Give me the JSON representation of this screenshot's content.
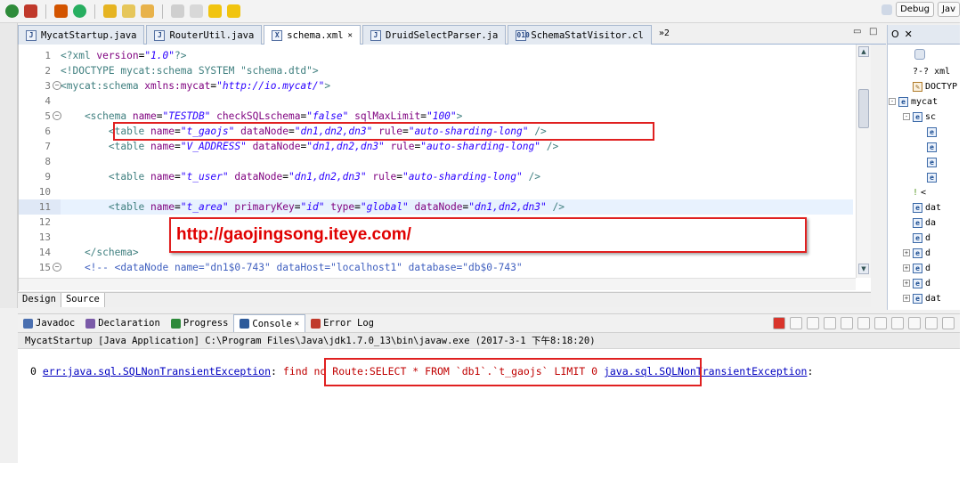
{
  "toolbar": {
    "perspective_debug": "Debug",
    "perspective_java": "Jav"
  },
  "editor_tabs": [
    {
      "label": "MycatStartup.java",
      "icon": "J"
    },
    {
      "label": "RouterUtil.java",
      "icon": "J"
    },
    {
      "label": "schema.xml",
      "icon": "X",
      "active": true
    },
    {
      "label": "DruidSelectParser.ja",
      "icon": "J"
    },
    {
      "label": "SchemaStatVisitor.cl",
      "icon": "010"
    }
  ],
  "editor_tabs_more": "»2",
  "editor": {
    "line_numbers": [
      "1",
      "2",
      "3",
      "4",
      "5",
      "6",
      "7",
      "8",
      "9",
      "10",
      "11",
      "12",
      "13",
      "14",
      "15"
    ],
    "lines": [
      {
        "parts": [
          {
            "t": "<?xml ",
            "c": "tg"
          },
          {
            "t": "version",
            "c": "at"
          },
          {
            "t": "=",
            "c": ""
          },
          {
            "t": "\"1.0\"",
            "c": "av"
          },
          {
            "t": "?>",
            "c": "tg"
          }
        ]
      },
      {
        "parts": [
          {
            "t": "<!DOCTYPE mycat:schema SYSTEM \"schema.dtd\">",
            "c": "tg"
          }
        ]
      },
      {
        "parts": [
          {
            "t": "<mycat:schema ",
            "c": "tg"
          },
          {
            "t": "xmlns:mycat",
            "c": "at"
          },
          {
            "t": "=",
            "c": ""
          },
          {
            "t": "\"http://io.mycat/\"",
            "c": "av"
          },
          {
            "t": ">",
            "c": "tg"
          }
        ]
      },
      {
        "parts": []
      },
      {
        "parts": [
          {
            "t": "    <schema ",
            "c": "tg"
          },
          {
            "t": "name",
            "c": "at"
          },
          {
            "t": "=",
            "c": ""
          },
          {
            "t": "\"TESTDB\"",
            "c": "av"
          },
          {
            "t": " ",
            "c": ""
          },
          {
            "t": "checkSQLschema",
            "c": "at"
          },
          {
            "t": "=",
            "c": ""
          },
          {
            "t": "\"false\"",
            "c": "av"
          },
          {
            "t": " ",
            "c": ""
          },
          {
            "t": "sqlMaxLimit",
            "c": "at"
          },
          {
            "t": "=",
            "c": ""
          },
          {
            "t": "\"100\"",
            "c": "av"
          },
          {
            "t": ">",
            "c": "tg"
          }
        ]
      },
      {
        "parts": [
          {
            "t": "        <table ",
            "c": "tg"
          },
          {
            "t": "name",
            "c": "at"
          },
          {
            "t": "=",
            "c": ""
          },
          {
            "t": "\"t_gaojs\"",
            "c": "av"
          },
          {
            "t": " ",
            "c": ""
          },
          {
            "t": "dataNode",
            "c": "at"
          },
          {
            "t": "=",
            "c": ""
          },
          {
            "t": "\"dn1,dn2,dn3\"",
            "c": "av"
          },
          {
            "t": " ",
            "c": ""
          },
          {
            "t": "rule",
            "c": "at"
          },
          {
            "t": "=",
            "c": ""
          },
          {
            "t": "\"auto-sharding-long\"",
            "c": "av"
          },
          {
            "t": " />",
            "c": "tg"
          }
        ]
      },
      {
        "parts": [
          {
            "t": "        <table ",
            "c": "tg"
          },
          {
            "t": "name",
            "c": "at"
          },
          {
            "t": "=",
            "c": ""
          },
          {
            "t": "\"V_ADDRESS\"",
            "c": "av"
          },
          {
            "t": " ",
            "c": ""
          },
          {
            "t": "dataNode",
            "c": "at"
          },
          {
            "t": "=",
            "c": ""
          },
          {
            "t": "\"dn1,dn2,dn3\"",
            "c": "av"
          },
          {
            "t": " ",
            "c": ""
          },
          {
            "t": "rule",
            "c": "at"
          },
          {
            "t": "=",
            "c": ""
          },
          {
            "t": "\"auto-sharding-long\"",
            "c": "av"
          },
          {
            "t": " />",
            "c": "tg"
          }
        ]
      },
      {
        "parts": []
      },
      {
        "parts": [
          {
            "t": "        <table ",
            "c": "tg"
          },
          {
            "t": "name",
            "c": "at"
          },
          {
            "t": "=",
            "c": ""
          },
          {
            "t": "\"t_user\"",
            "c": "av"
          },
          {
            "t": " ",
            "c": ""
          },
          {
            "t": "dataNode",
            "c": "at"
          },
          {
            "t": "=",
            "c": ""
          },
          {
            "t": "\"dn1,dn2,dn3\"",
            "c": "av"
          },
          {
            "t": " ",
            "c": ""
          },
          {
            "t": "rule",
            "c": "at"
          },
          {
            "t": "=",
            "c": ""
          },
          {
            "t": "\"auto-sharding-long\"",
            "c": "av"
          },
          {
            "t": " />",
            "c": "tg"
          }
        ]
      },
      {
        "parts": []
      },
      {
        "parts": [
          {
            "t": "        <table ",
            "c": "tg"
          },
          {
            "t": "name",
            "c": "at"
          },
          {
            "t": "=",
            "c": ""
          },
          {
            "t": "\"t_area\"",
            "c": "av"
          },
          {
            "t": " ",
            "c": ""
          },
          {
            "t": "primaryKey",
            "c": "at"
          },
          {
            "t": "=",
            "c": ""
          },
          {
            "t": "\"id\"",
            "c": "av"
          },
          {
            "t": " ",
            "c": ""
          },
          {
            "t": "type",
            "c": "at"
          },
          {
            "t": "=",
            "c": ""
          },
          {
            "t": "\"global\"",
            "c": "av"
          },
          {
            "t": " ",
            "c": ""
          },
          {
            "t": "dataNode",
            "c": "at"
          },
          {
            "t": "=",
            "c": ""
          },
          {
            "t": "\"dn1,dn2,dn3\"",
            "c": "av"
          },
          {
            "t": " />",
            "c": "tg"
          }
        ],
        "highlight": true
      },
      {
        "parts": []
      },
      {
        "parts": []
      },
      {
        "parts": [
          {
            "t": "    </schema>",
            "c": "tg"
          }
        ]
      },
      {
        "parts": [
          {
            "t": "    <!-- <dataNode name=\"dn1$0-743\" dataHost=\"localhost1\" database=\"db$0-743\"",
            "c": "cm"
          }
        ]
      }
    ],
    "fold_lines": [
      3,
      5,
      15
    ]
  },
  "annotation_url": "http://gaojingsong.iteye.com/",
  "design_tabs": [
    "Design",
    "Source"
  ],
  "outline": {
    "tab_label": "O",
    "rows": [
      {
        "indent": 1,
        "kind": "pi",
        "label": "?-? xml"
      },
      {
        "indent": 1,
        "kind": "doc",
        "label": "DOCTYP"
      },
      {
        "indent": 0,
        "kind": "e",
        "label": "mycat",
        "toggle": "-"
      },
      {
        "indent": 1,
        "kind": "e",
        "label": "sc",
        "toggle": "-"
      },
      {
        "indent": 2,
        "kind": "e",
        "label": ""
      },
      {
        "indent": 2,
        "kind": "e",
        "label": ""
      },
      {
        "indent": 2,
        "kind": "e",
        "label": ""
      },
      {
        "indent": 2,
        "kind": "e",
        "label": ""
      },
      {
        "indent": 1,
        "kind": "cm",
        "label": "<"
      },
      {
        "indent": 1,
        "kind": "e",
        "label": "dat"
      },
      {
        "indent": 1,
        "kind": "e",
        "label": "da"
      },
      {
        "indent": 1,
        "kind": "e",
        "label": "d"
      },
      {
        "indent": 1,
        "kind": "e",
        "label": "d",
        "toggle": "+"
      },
      {
        "indent": 1,
        "kind": "e",
        "label": "d",
        "toggle": "+"
      },
      {
        "indent": 1,
        "kind": "e",
        "label": "d",
        "toggle": "+"
      },
      {
        "indent": 1,
        "kind": "e",
        "label": "dat",
        "toggle": "+"
      }
    ]
  },
  "console_tabs": [
    {
      "label": "Javadoc",
      "icon": "at-icon",
      "color": "#4a6fb0"
    },
    {
      "label": "Declaration",
      "icon": "declaration-icon",
      "color": "#7a5aa8"
    },
    {
      "label": "Progress",
      "icon": "progress-icon",
      "color": "#2d8a3a"
    },
    {
      "label": "Console",
      "icon": "console-icon",
      "color": "#2d5a9a",
      "active": true
    },
    {
      "label": "Error Log",
      "icon": "error-log-icon",
      "color": "#c0392b"
    }
  ],
  "console": {
    "process_line": "MycatStartup [Java Application] C:\\Program Files\\Java\\jdk1.7.0_13\\bin\\javaw.exe (2017-3-1 下午8:18:20)",
    "output_prefix": "0 ",
    "link1": "err:java.sql.SQLNonTransientException",
    "sep1": ": ",
    "message": "find no Route:SELECT * FROM `db1`.`t_gaojs` LIMIT 0",
    "sep2": " ",
    "link2": "java.sql.SQLNonTransientException",
    "sep3": ":"
  },
  "colors": {
    "annotation_red": "#e02020",
    "xml_tag": "#3f7f7f",
    "xml_attr": "#7f007f",
    "xml_value": "#2a00ff",
    "comment": "#3f5fbf"
  }
}
